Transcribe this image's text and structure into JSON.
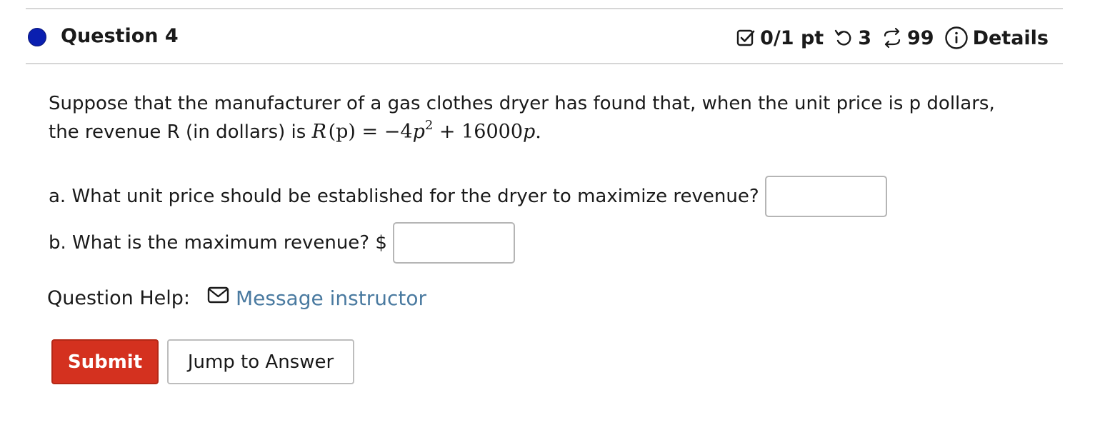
{
  "question": {
    "title": "Question 4",
    "status_color": "#0a1fb0"
  },
  "meta": {
    "score": "0/1 pt",
    "attempts": "3",
    "retries": "99",
    "details_label": "Details",
    "icons": [
      "score-check-icon",
      "undo-icon",
      "retry-arrows-icon",
      "info-icon"
    ]
  },
  "prompt": {
    "text_1": "Suppose that the manufacturer of a gas clothes dryer has found that, when the unit price is p dollars,",
    "text_2": "the revenue R (in dollars) is",
    "formula": {
      "lhs_var": "R",
      "lhs_arg": "(p)",
      "eq": " = −4",
      "p": "p",
      "exp": "2",
      "rest": " + 16000",
      "p2": "p",
      "end": "."
    }
  },
  "parts": {
    "a_label": "a. What unit price should be established for the dryer to maximize revenue?",
    "a_value": "",
    "b_label": "b. What is the maximum revenue? $",
    "b_value": ""
  },
  "help": {
    "label": "Question Help:",
    "link_label": "Message instructor"
  },
  "buttons": {
    "submit_label": "Submit",
    "jump_label": "Jump to Answer"
  },
  "colors": {
    "submit_bg": "#d4311f",
    "link": "#4a7aa0",
    "input_border": "#b5b5b5"
  }
}
